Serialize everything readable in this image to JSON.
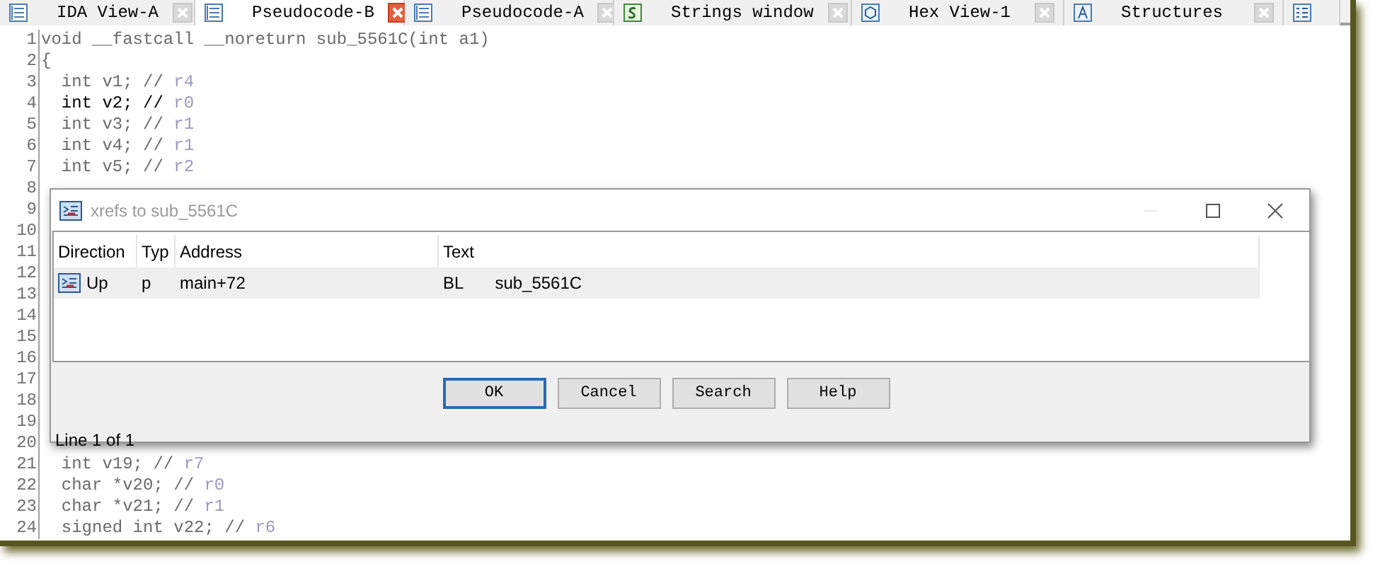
{
  "tabs": [
    {
      "label": "IDA View-A",
      "selected": false
    },
    {
      "label": "Pseudocode-B",
      "selected": true
    },
    {
      "label": "Pseudocode-A",
      "selected": false
    },
    {
      "label": "Strings window",
      "selected": false
    },
    {
      "label": "Hex View-1",
      "selected": false
    },
    {
      "label": "Structures",
      "selected": false
    },
    {
      "selected": false
    }
  ],
  "code_lines": [
    {
      "number": "1",
      "code": "void __fastcall __noreturn sub_5561C(int a1)",
      "highlighted": false
    },
    {
      "number": "2",
      "code": "{",
      "highlighted": false
    },
    {
      "number": "3",
      "code": "  int v1; //",
      "note": "r4",
      "highlighted": false
    },
    {
      "number": "4",
      "code": "  int v2; //",
      "note": "r0",
      "highlighted": true
    },
    {
      "number": "5",
      "code": "  int v3; //",
      "note": "r1",
      "highlighted": false
    },
    {
      "number": "6",
      "code": "  int v4; //",
      "note": "r1",
      "highlighted": false
    },
    {
      "number": "7",
      "code": "  int v5; //",
      "note": "r2",
      "highlighted": false
    },
    {
      "number": "8"
    },
    {
      "number": "9"
    },
    {
      "number": "10"
    },
    {
      "number": "11"
    },
    {
      "number": "12"
    },
    {
      "number": "13"
    },
    {
      "number": "14"
    },
    {
      "number": "15"
    },
    {
      "number": "16"
    },
    {
      "number": "17"
    },
    {
      "number": "18"
    },
    {
      "number": "19"
    },
    {
      "number": "20"
    },
    {
      "number": "21",
      "code": "  int v19; //",
      "note": "r7",
      "highlighted": false
    },
    {
      "number": "22",
      "code": "  char *v20; //",
      "note": "r0",
      "highlighted": false
    },
    {
      "number": "23",
      "code": "  char *v21; //",
      "note": "r1",
      "highlighted": false
    },
    {
      "number": "24",
      "code": "  signed int v22; //",
      "note": "r6",
      "highlighted": false
    }
  ],
  "dialog": {
    "title": "xrefs to sub_5561C",
    "columns": [
      "Direction",
      "Typ",
      "Address",
      "Text"
    ],
    "rows": [
      {
        "direction": "Up",
        "type": "p",
        "address": "main+72",
        "text": [
          "BL",
          "sub_5561C"
        ],
        "selected": true
      }
    ],
    "buttons": [
      {
        "label": "OK",
        "default": true
      },
      {
        "label": "Cancel",
        "default": false
      },
      {
        "label": "Search",
        "default": false
      },
      {
        "label": "Help",
        "default": false
      }
    ],
    "status": "Line 1 of 1"
  }
}
